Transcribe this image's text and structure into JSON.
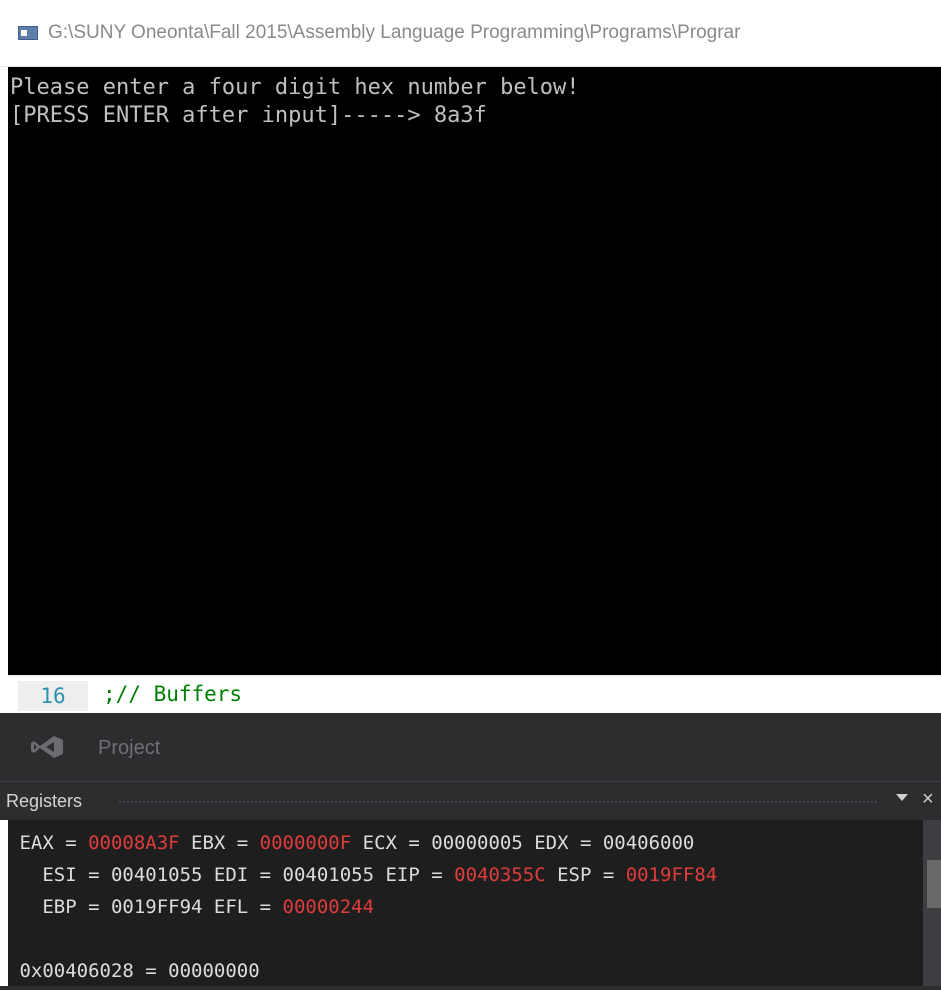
{
  "window": {
    "title": "G:\\SUNY Oneonta\\Fall 2015\\Assembly Language Programming\\Programs\\Prograr",
    "icon": "console-app-icon"
  },
  "console": {
    "lines": [
      "Please enter a four digit hex number below!",
      "[PRESS ENTER after input]-----> 8a3f"
    ]
  },
  "editor": {
    "line_number": "16",
    "code": ";// Buffers"
  },
  "panel": {
    "icon": "visual-studio-icon",
    "project_tab": "Project"
  },
  "registers": {
    "title": "Registers",
    "rows": [
      {
        "prefix": " EAX = ",
        "v1": "00008A3F",
        "m1": " EBX = ",
        "v2": "0000000F",
        "rest": " ECX = 00000005 EDX = 00406000"
      },
      {
        "prefix": "   ESI = 00401055 EDI = 00401055 EIP = ",
        "v1": "0040355C",
        "m1": " ESP = ",
        "v2": "0019FF84"
      },
      {
        "prefix": "   EBP = 0019FF94 EFL = ",
        "v1": "00000244"
      }
    ],
    "memory": " 0x00406028 = 00000000",
    "changed_color": "#e03c3c"
  }
}
